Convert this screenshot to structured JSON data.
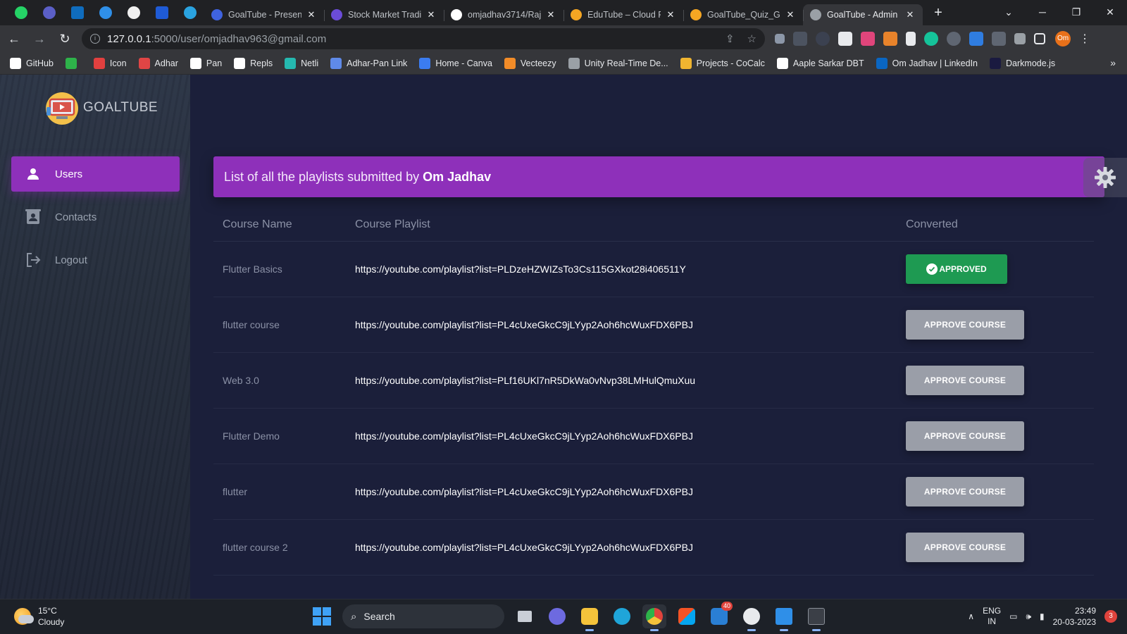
{
  "browser": {
    "tabs": [
      {
        "title": "GoalTube - Present",
        "active": false,
        "color": "#3f63e0"
      },
      {
        "title": "Stock Market Tradi",
        "active": false,
        "color": "#6b4cd8"
      },
      {
        "title": "omjadhav3714/Raj",
        "active": false,
        "color": "#ffffff"
      },
      {
        "title": "EduTube – Cloud F",
        "active": false,
        "color": "#f5a623"
      },
      {
        "title": "GoalTube_Quiz_Ge",
        "active": false,
        "color": "#f5a623"
      },
      {
        "title": "GoalTube - Admin",
        "active": true,
        "color": "#9aa0a6"
      }
    ],
    "url_host": "127.0.0.1",
    "url_path": ":5000/user/omjadhav963@gmail.com",
    "profile_initials": "Om",
    "bookmarks": [
      {
        "label": "GitHub",
        "color": "#ffffff"
      },
      {
        "label": "",
        "color": "#2eb34a"
      },
      {
        "label": "Icon",
        "color": "#e2403f"
      },
      {
        "label": "Adhar",
        "color": "#e04545"
      },
      {
        "label": "Pan",
        "color": "#ffffff"
      },
      {
        "label": "Repls",
        "color": "#ffffff"
      },
      {
        "label": "Netli",
        "color": "#25b9b0"
      },
      {
        "label": "Adhar-Pan Link",
        "color": "#5f8ae8"
      },
      {
        "label": "Home - Canva",
        "color": "#3b7cf0"
      },
      {
        "label": "Vecteezy",
        "color": "#f28c28"
      },
      {
        "label": "Unity Real-Time De...",
        "color": "#9aa0a6"
      },
      {
        "label": "Projects - CoCalc",
        "color": "#f0b530"
      },
      {
        "label": "Aaple Sarkar DBT",
        "color": "#ffffff"
      },
      {
        "label": "Om Jadhav | LinkedIn",
        "color": "#0a66c2"
      },
      {
        "label": "Darkmode.js",
        "color": "#1a1a40"
      }
    ]
  },
  "app": {
    "brand": "GOALTUBE",
    "nav": [
      {
        "label": "Users",
        "active": true,
        "icon": "user-icon"
      },
      {
        "label": "Contacts",
        "active": false,
        "icon": "contacts-icon"
      },
      {
        "label": "Logout",
        "active": false,
        "icon": "logout-icon"
      }
    ],
    "banner_prefix": "List of all the playlists submitted by",
    "banner_user": "Om Jadhav",
    "columns": [
      "Course Name",
      "Course Playlist",
      "Converted"
    ],
    "rows": [
      {
        "name": "Flutter Basics",
        "playlist": "https://youtube.com/playlist?list=PLDzeHZWIZsTo3Cs115GXkot28i406511Y",
        "status": "APPROVED",
        "approved": true
      },
      {
        "name": "flutter course",
        "playlist": "https://youtube.com/playlist?list=PL4cUxeGkcC9jLYyp2Aoh6hcWuxFDX6PBJ",
        "status": "APPROVE COURSE",
        "approved": false
      },
      {
        "name": "Web 3.0",
        "playlist": "https://youtube.com/playlist?list=PLf16UKl7nR5DkWa0vNvp38LMHulQmuXuu",
        "status": "APPROVE COURSE",
        "approved": false
      },
      {
        "name": "Flutter Demo",
        "playlist": "https://youtube.com/playlist?list=PL4cUxeGkcC9jLYyp2Aoh6hcWuxFDX6PBJ",
        "status": "APPROVE COURSE",
        "approved": false
      },
      {
        "name": "flutter",
        "playlist": "https://youtube.com/playlist?list=PL4cUxeGkcC9jLYyp2Aoh6hcWuxFDX6PBJ",
        "status": "APPROVE COURSE",
        "approved": false
      },
      {
        "name": "flutter course 2",
        "playlist": "https://youtube.com/playlist?list=PL4cUxeGkcC9jLYyp2Aoh6hcWuxFDX6PBJ",
        "status": "APPROVE COURSE",
        "approved": false
      }
    ],
    "colors": {
      "accent": "#8e30ba",
      "approved": "#1e9a52",
      "approve_btn": "#9a9ea8",
      "background": "#1b1f3a"
    }
  },
  "taskbar": {
    "temperature": "15°C",
    "weather": "Cloudy",
    "search_label": "Search",
    "lang_top": "ENG",
    "lang_bottom": "IN",
    "time": "23:49",
    "date": "20-03-2023",
    "notification_count": "3",
    "mail_badge": "40"
  }
}
